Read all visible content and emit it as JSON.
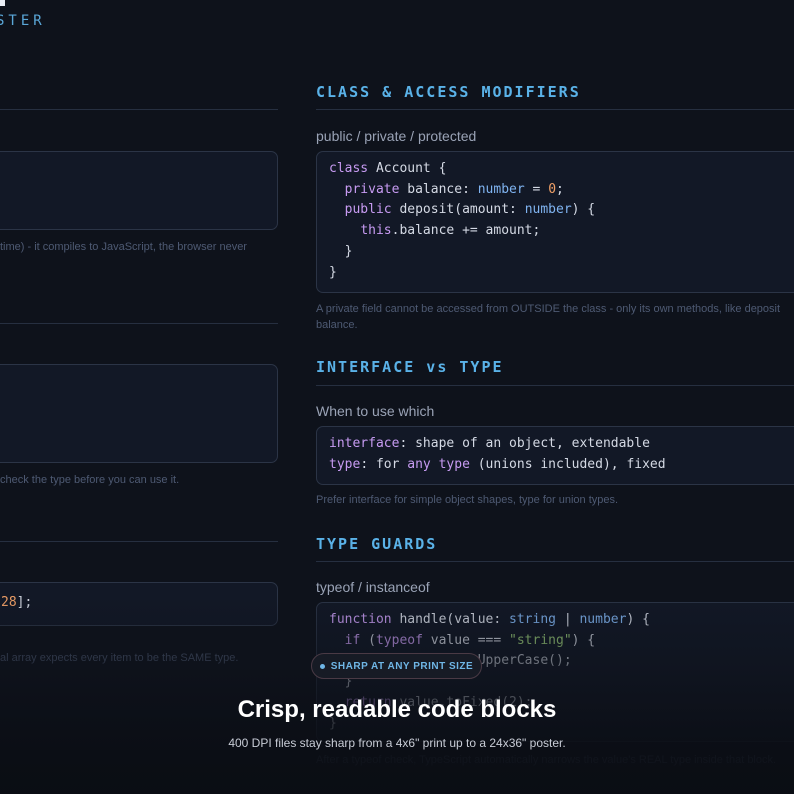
{
  "poster_subtitle": "STER",
  "left_column": {
    "note1": "time) - it compiles to JavaScript, the browser never",
    "note2": "check the type before you can use it.",
    "code_fragment": "28",
    "code_tail": "];",
    "note3": "al array expects every item to be the SAME type."
  },
  "sections": {
    "class": {
      "title": "CLASS & ACCESS MODIFIERS",
      "subtitle": "public / private / protected",
      "note": "A private field cannot be accessed from OUTSIDE the class - only its own methods, like deposit",
      "note2": "balance."
    },
    "interface": {
      "title": "INTERFACE vs TYPE",
      "subtitle": "When to use which",
      "note": "Prefer interface for simple object shapes, type for union types."
    },
    "guards": {
      "title": "TYPE GUARDS",
      "subtitle": "typeof / instanceof",
      "note": "After a typeof check, TypeScript automatically narrows the value's REAL type inside that block."
    }
  },
  "overlay": {
    "badge": "SHARP AT ANY PRINT SIZE",
    "headline": "Crisp, readable code blocks",
    "caption": "400 DPI files stay sharp from a 4x6\" print up to a 24x36\" poster."
  },
  "colors": {
    "background": "#0e121b",
    "section_title": "#5ab2e8",
    "keyword": "#c79bf2",
    "type": "#7fb3f0",
    "number": "#f0a067",
    "string": "#9ccf7b"
  }
}
